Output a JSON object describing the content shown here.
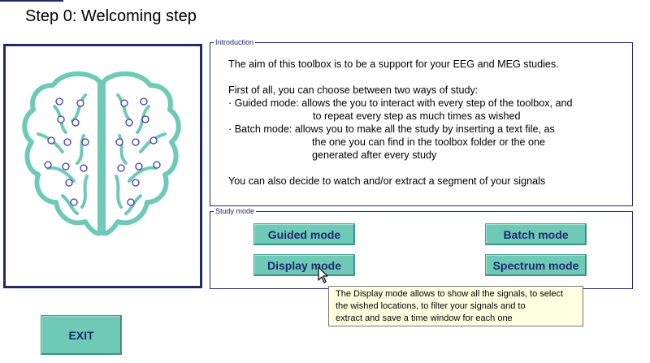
{
  "page": {
    "title": "Step 0: Welcoming step"
  },
  "introduction": {
    "legend": "Introduction",
    "line1": "The aim of this toolbox is to be a support for your EEG and MEG studies.",
    "line2": "First of all, you can choose between two ways of study:",
    "line3": "· Guided mode: allows the you to interact with every step of the toolbox, and",
    "line4": "to repeat every step as much times as wished",
    "line5": "· Batch mode: allows you to make all the study by inserting a text file, as",
    "line6": "the one you can find in the toolbox folder or the one",
    "line7": "generated after every study",
    "line8": "You can also decide to watch and/or extract a segment of your signals"
  },
  "study_mode": {
    "legend": "Study mode",
    "guided": "Guided mode",
    "batch": "Batch mode",
    "display": "Display mode",
    "spectrum": "Spectrum mode"
  },
  "exit_label": "EXIT",
  "tooltip": {
    "line1": "The Display mode allows to show all the signals, to select",
    "line2": "the wished locations, to filter your signals and to",
    "line3": "extract and save a time window for each one"
  },
  "colors": {
    "accent": "#6ec9b7",
    "navy": "#1f2a6b",
    "tooltip_bg": "#ffffe1"
  },
  "icons": {
    "brain": "brain-icon",
    "cursor": "mouse-pointer-icon"
  }
}
